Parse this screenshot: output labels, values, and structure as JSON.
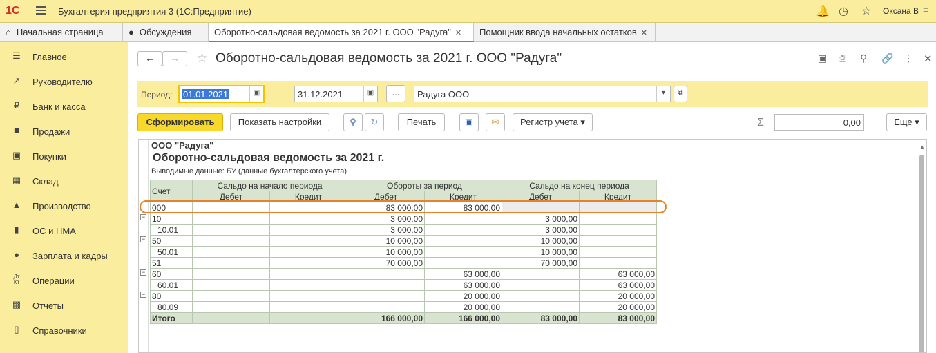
{
  "app": {
    "logo": "1С",
    "title": "Бухгалтерия предприятия 3  (1С:Предприятие)",
    "user": "Оксана В"
  },
  "tabs": [
    {
      "label": "Начальная страница"
    },
    {
      "label": "Обсуждения"
    },
    {
      "label": "Оборотно-сальдовая ведомость за 2021 г. ООО \"Радуга\""
    },
    {
      "label": "Помощник ввода начальных остатков"
    }
  ],
  "sidebar": {
    "items": [
      {
        "label": "Главное",
        "icon": "menu-icon"
      },
      {
        "label": "Руководителю",
        "icon": "trend-icon"
      },
      {
        "label": "Банк и касса",
        "icon": "ruble-icon"
      },
      {
        "label": "Продажи",
        "icon": "bag-icon"
      },
      {
        "label": "Покупки",
        "icon": "cart-icon"
      },
      {
        "label": "Склад",
        "icon": "warehouse-icon"
      },
      {
        "label": "Производство",
        "icon": "factory-icon"
      },
      {
        "label": "ОС и НМА",
        "icon": "truck-icon"
      },
      {
        "label": "Зарплата и кадры",
        "icon": "person-icon"
      },
      {
        "label": "Операции",
        "icon": "dt-kt-icon"
      },
      {
        "label": "Отчеты",
        "icon": "bar-chart-icon"
      },
      {
        "label": "Справочники",
        "icon": "book-icon"
      }
    ]
  },
  "page": {
    "title": "Оборотно-сальдовая ведомость за 2021 г. ООО \"Радуга\""
  },
  "filters": {
    "period_label": "Период:",
    "date_from": "01.01.2021",
    "dash": "–",
    "date_to": "31.12.2021",
    "dots": "...",
    "org": "Радуга ООО"
  },
  "toolbar": {
    "generate": "Сформировать",
    "settings": "Показать настройки",
    "print": "Печать",
    "register": "Регистр учета",
    "sum": "0,00",
    "more": "Еще"
  },
  "report": {
    "org": "ООО \"Радуга\"",
    "title": "Оборотно-сальдовая ведомость за 2021 г.",
    "subtitle": "Выводимые данные:  БУ (данные бухгалтерского учета)",
    "headers": {
      "account": "Счет",
      "opening": "Сальдо на начало периода",
      "turnover": "Обороты за период",
      "closing": "Сальдо на конец периода",
      "debit": "Дебет",
      "credit": "Кредит"
    },
    "rows": [
      {
        "account": "000",
        "od": "",
        "oc": "",
        "td": "83 000,00",
        "tc": "83 000,00",
        "cd": "",
        "cc": ""
      },
      {
        "account": "10",
        "od": "",
        "oc": "",
        "td": "3 000,00",
        "tc": "",
        "cd": "3 000,00",
        "cc": ""
      },
      {
        "account": "10.01",
        "od": "",
        "oc": "",
        "td": "3 000,00",
        "tc": "",
        "cd": "3 000,00",
        "cc": ""
      },
      {
        "account": "50",
        "od": "",
        "oc": "",
        "td": "10 000,00",
        "tc": "",
        "cd": "10 000,00",
        "cc": ""
      },
      {
        "account": "50.01",
        "od": "",
        "oc": "",
        "td": "10 000,00",
        "tc": "",
        "cd": "10 000,00",
        "cc": ""
      },
      {
        "account": "51",
        "od": "",
        "oc": "",
        "td": "70 000,00",
        "tc": "",
        "cd": "70 000,00",
        "cc": ""
      },
      {
        "account": "60",
        "od": "",
        "oc": "",
        "td": "",
        "tc": "63 000,00",
        "cd": "",
        "cc": "63 000,00"
      },
      {
        "account": "60.01",
        "od": "",
        "oc": "",
        "td": "",
        "tc": "63 000,00",
        "cd": "",
        "cc": "63 000,00"
      },
      {
        "account": "80",
        "od": "",
        "oc": "",
        "td": "",
        "tc": "20 000,00",
        "cd": "",
        "cc": "20 000,00"
      },
      {
        "account": "80.09",
        "od": "",
        "oc": "",
        "td": "",
        "tc": "20 000,00",
        "cd": "",
        "cc": "20 000,00"
      }
    ],
    "total": {
      "account": "Итого",
      "od": "",
      "oc": "",
      "td": "166 000,00",
      "tc": "166 000,00",
      "cd": "83 000,00",
      "cc": "83 000,00"
    }
  },
  "colors": {
    "accent": "#fbed9e",
    "button": "#f8d82a",
    "highlight": "#e8822a",
    "header_fill": "#d9e4d0"
  }
}
